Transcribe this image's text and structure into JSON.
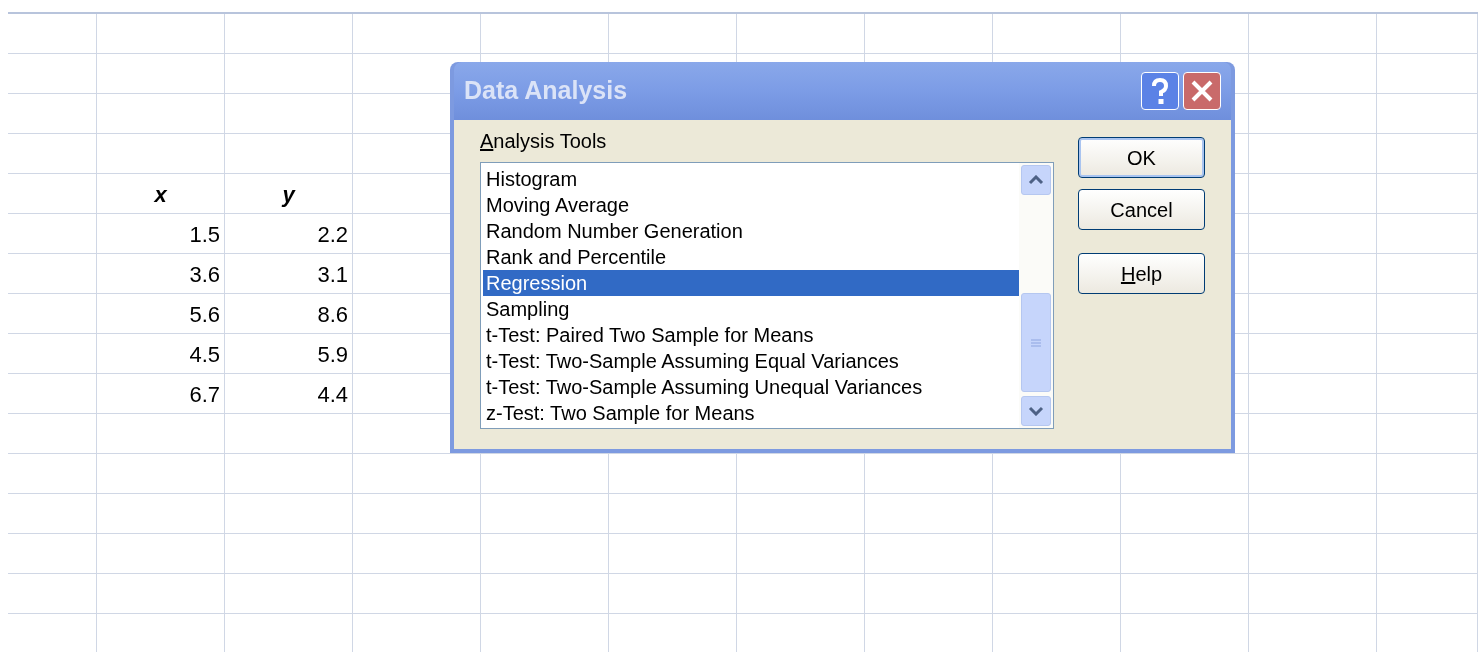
{
  "sheet": {
    "headers": [
      "x",
      "y"
    ],
    "rows": [
      [
        "1.5",
        "2.2"
      ],
      [
        "3.6",
        "3.1"
      ],
      [
        "5.6",
        "8.6"
      ],
      [
        "4.5",
        "5.9"
      ],
      [
        "6.7",
        "4.4"
      ]
    ]
  },
  "dialog": {
    "title": "Data Analysis",
    "list_label": "Analysis Tools",
    "items": [
      {
        "label": "Histogram",
        "selected": false
      },
      {
        "label": "Moving Average",
        "selected": false
      },
      {
        "label": "Random Number Generation",
        "selected": false
      },
      {
        "label": "Rank and Percentile",
        "selected": false
      },
      {
        "label": "Regression",
        "selected": true
      },
      {
        "label": "Sampling",
        "selected": false
      },
      {
        "label": "t-Test: Paired Two Sample for Means",
        "selected": false
      },
      {
        "label": "t-Test: Two-Sample Assuming Equal Variances",
        "selected": false
      },
      {
        "label": "t-Test: Two-Sample Assuming Unequal Variances",
        "selected": false
      },
      {
        "label": "z-Test: Two Sample for Means",
        "selected": false
      }
    ],
    "buttons": [
      "OK",
      "Cancel",
      "Help"
    ]
  }
}
